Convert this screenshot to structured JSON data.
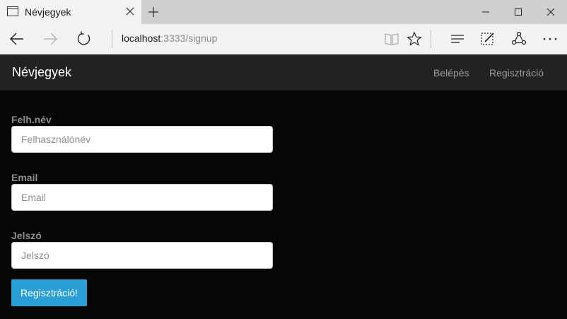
{
  "browser": {
    "tab_title": "Névjegyek",
    "url_host": "localhost",
    "url_rest": ":3333/signup"
  },
  "navbar": {
    "brand": "Névjegyek",
    "links": [
      "Belépés",
      "Regisztráció"
    ]
  },
  "form": {
    "username": {
      "label": "Felh.név",
      "placeholder": "Felhasználónév"
    },
    "email": {
      "label": "Email",
      "placeholder": "Email"
    },
    "password": {
      "label": "Jelszó",
      "placeholder": "Jelszó"
    },
    "submit": "Regisztráció!"
  },
  "colors": {
    "page_bg": "#060606",
    "navbar_bg": "#222222",
    "button_bg": "#2a9fd6"
  }
}
